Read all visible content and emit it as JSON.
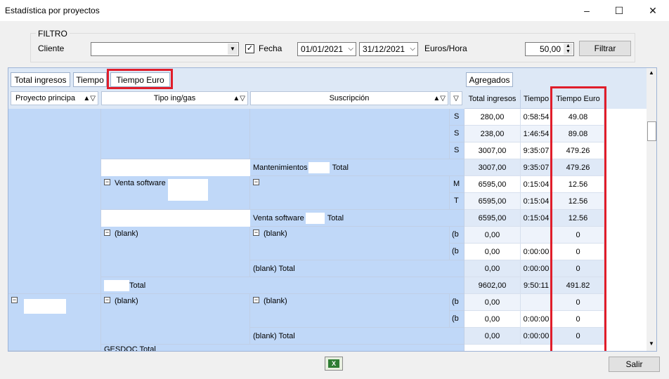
{
  "window": {
    "title": "Estadística por proyectos",
    "min": "–",
    "max": "☐",
    "close": "✕"
  },
  "filter": {
    "label": "FILTRO",
    "cliente_label": "Cliente",
    "cliente_value": "",
    "fecha_label": "Fecha",
    "fecha_checked": "✓",
    "date_from": "01/01/2021",
    "date_to": "31/12/2021",
    "euros_label": "Euros/Hora",
    "euros_value": "50,00",
    "filtrar": "Filtrar"
  },
  "data_buttons": [
    "Total ingresos",
    "Tiempo",
    "Tiempo Euro"
  ],
  "aggregados": "Agregados",
  "row_headers": [
    "Proyecto principa",
    "Tipo ing/gas",
    "Suscripción"
  ],
  "col_headers": [
    "Total ingresos",
    "Tiempo",
    "Tiempo Euro"
  ],
  "row_labels": {
    "mantenimientos_total": "Mantenimientos",
    "total_word": "Total",
    "venta_software": "Venta software",
    "venta_software_total": "Venta software",
    "blank": "(blank)",
    "blank_total": "(blank) Total",
    "grand_total": "Total",
    "gesdoc_total": "GESDOC Total",
    "s": "S",
    "m": "M",
    "t": "T",
    "b": "(b"
  },
  "rows": [
    {
      "ing": "280,00",
      "tiempo": "0:58:54",
      "euro": "49.08"
    },
    {
      "ing": "238,00",
      "tiempo": "1:46:54",
      "euro": "89.08"
    },
    {
      "ing": "3007,00",
      "tiempo": "9:35:07",
      "euro": "479.26"
    },
    {
      "ing": "3007,00",
      "tiempo": "9:35:07",
      "euro": "479.26"
    },
    {
      "ing": "6595,00",
      "tiempo": "0:15:04",
      "euro": "12.56"
    },
    {
      "ing": "6595,00",
      "tiempo": "0:15:04",
      "euro": "12.56"
    },
    {
      "ing": "6595,00",
      "tiempo": "0:15:04",
      "euro": "12.56"
    },
    {
      "ing": "0,00",
      "tiempo": "",
      "euro": "0"
    },
    {
      "ing": "0,00",
      "tiempo": "0:00:00",
      "euro": "0"
    },
    {
      "ing": "0,00",
      "tiempo": "0:00:00",
      "euro": "0"
    },
    {
      "ing": "9602,00",
      "tiempo": "9:50:11",
      "euro": "491.82"
    },
    {
      "ing": "0,00",
      "tiempo": "",
      "euro": "0"
    },
    {
      "ing": "0,00",
      "tiempo": "0:00:00",
      "euro": "0"
    },
    {
      "ing": "0,00",
      "tiempo": "0:00:00",
      "euro": "0"
    }
  ],
  "salir": "Salir"
}
